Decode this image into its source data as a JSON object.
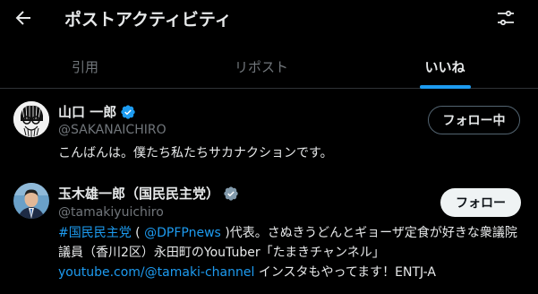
{
  "header": {
    "title": "ポストアクティビティ",
    "back_icon": "arrow-left-icon",
    "filter_icon": "sliders-icon"
  },
  "tabs": [
    {
      "label": "引用",
      "active": false
    },
    {
      "label": "リポスト",
      "active": false
    },
    {
      "label": "いいね",
      "active": true
    }
  ],
  "colors": {
    "background": "#000000",
    "text": "#e7e9ea",
    "secondary": "#71767b",
    "accent": "#1d9bf0",
    "verified_blue": "#1d9bf0",
    "verified_gray": "#829aab"
  },
  "users": [
    {
      "name": "山口 一郎",
      "handle": "@SAKANAICHIRO",
      "verified": "blue",
      "follow_label": "フォロー中",
      "bio": "こんばんは。僕たち私たちサカナクションです。"
    },
    {
      "name": "玉木雄一郎（国民民主党）",
      "handle": "@tamakiyuichiro",
      "verified": "gray",
      "follow_label": "フォロー",
      "bio_parts": {
        "hashtag": "#国民民主党",
        "t1": " ( ",
        "mention": "@DPFPnews",
        "t2": " )代表。さぬきうどんとギョーザ定食が好きな衆議院議員（香川2区）永田町のYouTuber「たまきチャンネル」",
        "url": "youtube.com/@tamaki-channel",
        "t3": " インスタもやってます！ENTJ-A"
      }
    }
  ]
}
